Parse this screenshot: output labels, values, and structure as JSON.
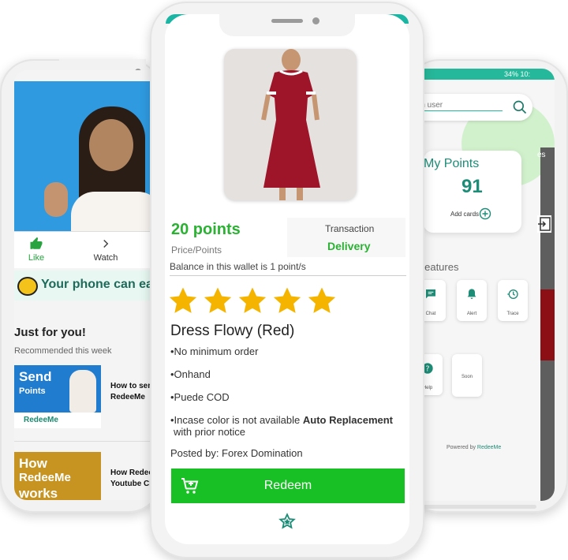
{
  "left_phone": {
    "actions": [
      {
        "icon": "thumbs-up-icon",
        "label": "Like"
      },
      {
        "icon": "chevron-right-icon",
        "label": "Watch"
      }
    ],
    "banner_text": "Your phone can ea",
    "just_for_you": "Just for you!",
    "recommended": "Recommended this week",
    "videos": [
      {
        "thumb_title": "Send",
        "thumb_sub": "Points",
        "brand": "RedeeMe",
        "title_l1": "How to sen",
        "title_l2": "RedeeMe"
      },
      {
        "thumb_title": "How",
        "thumb_title2": "RedeeMe",
        "thumb_title3": "works",
        "title_l1": "How Redee",
        "title_l2": "Youtube Cl"
      }
    ]
  },
  "center_phone": {
    "points": "20 points",
    "price_label": "Price/Points",
    "transaction_label": "Transaction",
    "transaction_value": "Delivery",
    "balance": "Balance in this wallet is 1 point/s",
    "rating": 5,
    "star_color": "#f5b400",
    "product_name": "Dress Flowy (Red)",
    "bullets": [
      "•No minimum order",
      "•Onhand",
      "•Puede COD"
    ],
    "bullet4_pre": "•Incase color is not available ",
    "bullet4_bold": "Auto Replacement",
    "bullet4_post": "with prior notice",
    "posted_by": "Posted by: Forex Domination",
    "redeem_label": "Redeem",
    "accent": "#19c025"
  },
  "right_phone": {
    "status": "34% 10:",
    "search_placeholder": "rch user",
    "my_points_title": "My Points",
    "my_points_value": "91",
    "add_cards": "Add cards",
    "side_tab": "es",
    "other_features": "er Features",
    "features": [
      {
        "icon": "chat-icon",
        "label": "Chat"
      },
      {
        "icon": "alert-icon",
        "label": "Alert"
      },
      {
        "icon": "trace-icon",
        "label": "Trace"
      },
      {
        "icon": "help-icon",
        "label": "Help"
      },
      {
        "icon": "",
        "label": "Soon"
      }
    ],
    "powered_by_pre": "Powered by ",
    "powered_by_brand": "RedeeMe",
    "teal": "#26b89a"
  }
}
